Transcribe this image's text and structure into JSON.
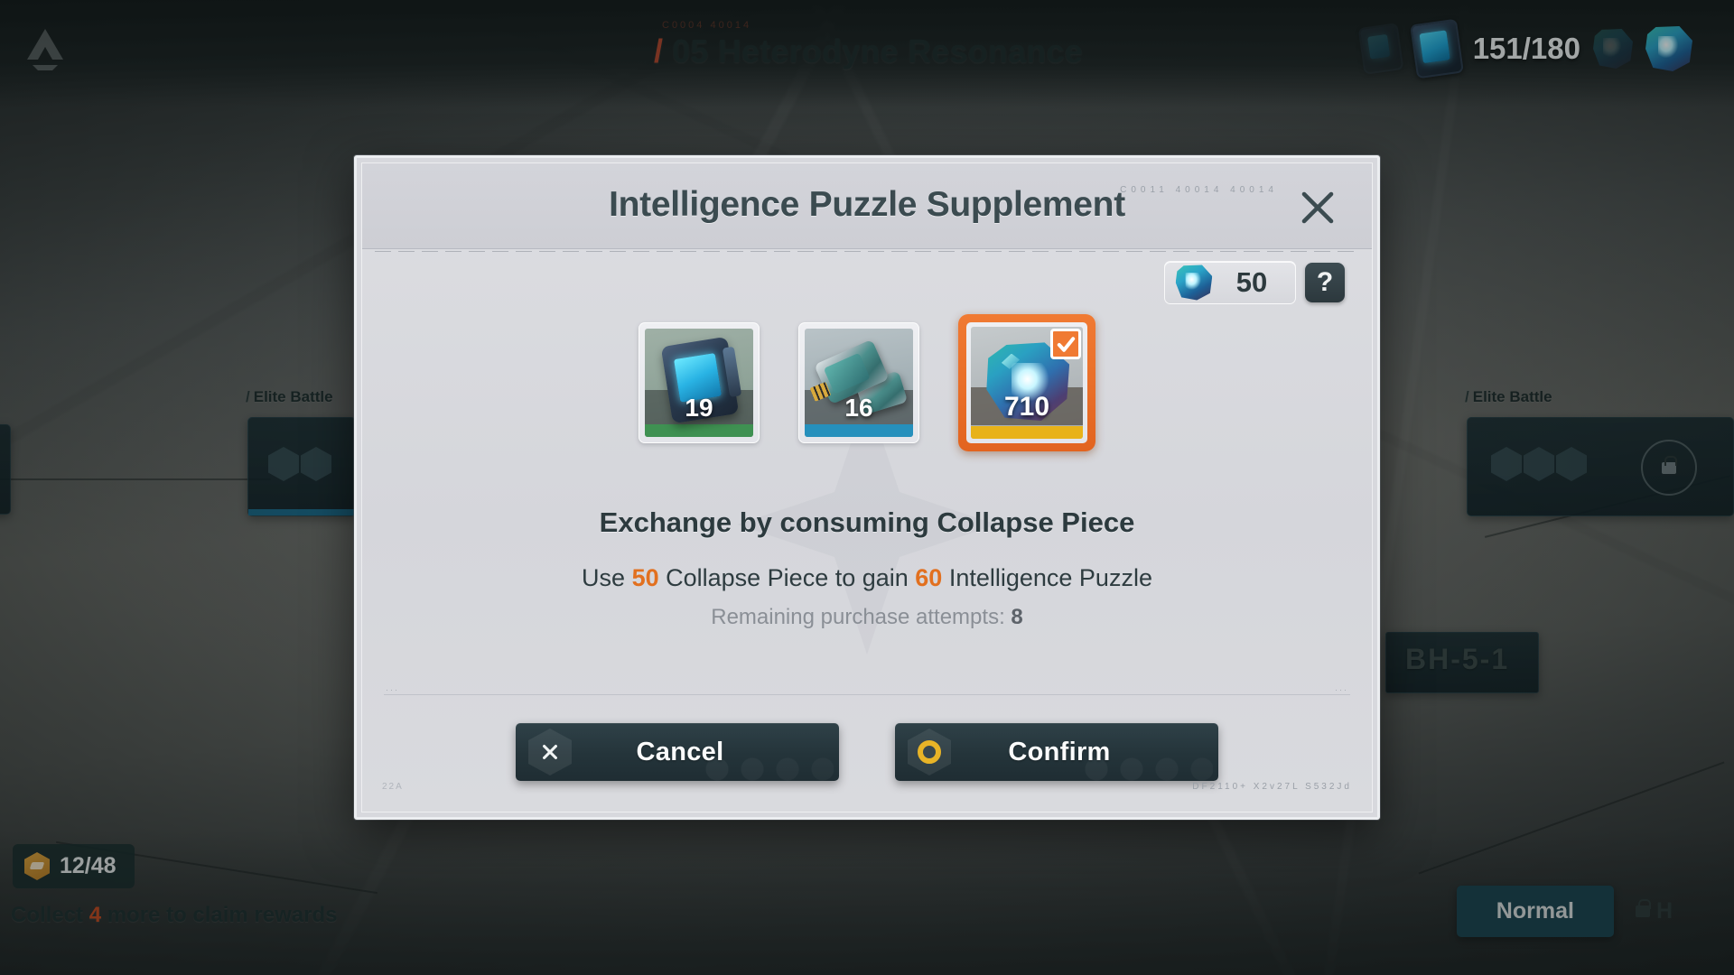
{
  "background": {
    "stage_title": "05 Heterodyne Resonance",
    "stage_title_slash": "/",
    "stage_subcode": "C0004  40014",
    "stamina": "151/180",
    "map_labels": [
      {
        "slash": "/",
        "text": "Elite Battle"
      },
      {
        "slash": "/",
        "text": "Elite Battle"
      }
    ],
    "stage_code": "BH-5-1",
    "rewards_count": "12/48",
    "rewards_text_prefix": "Collect ",
    "rewards_text_num": "4",
    "rewards_text_suffix": " more to claim rewards",
    "difficulty_normal": "Normal",
    "difficulty_hard": "H"
  },
  "dialog": {
    "title": "Intelligence Puzzle Supplement",
    "header_code": "C0011  40014   40014",
    "close_icon": "close-icon",
    "currency": {
      "icon": "collapse-piece-gem-icon",
      "value": "50",
      "help_label": "?"
    },
    "items": [
      {
        "name": "intelligence-puzzle-device",
        "count": "19",
        "quality": "green",
        "quality_color": "#3f9152",
        "selected": false
      },
      {
        "name": "key-chip",
        "count": "16",
        "quality": "blue",
        "quality_color": "#2690bc",
        "selected": false
      },
      {
        "name": "collapse-piece-crystal",
        "count": "710",
        "quality": "gold",
        "quality_color": "#e8b219",
        "selected": true
      }
    ],
    "headline": "Exchange by consuming Collapse Piece",
    "exchange": {
      "part1": "Use ",
      "cost": "50",
      "part2": " Collapse Piece to gain ",
      "gain": "60",
      "part3": " Intelligence Puzzle"
    },
    "attempts": {
      "label": "Remaining purchase attempts: ",
      "value": "8"
    },
    "buttons": {
      "cancel": "Cancel",
      "confirm": "Confirm"
    },
    "footer_code_left": "22A",
    "footer_code_right": "DF2110+  X2v27L   S532Jd"
  },
  "colors": {
    "accent_orange": "#e2701f",
    "selected_border": "#e2641f",
    "panel": "#d7d8dd",
    "button_dark": "#24343a",
    "gold": "#e8b427"
  }
}
